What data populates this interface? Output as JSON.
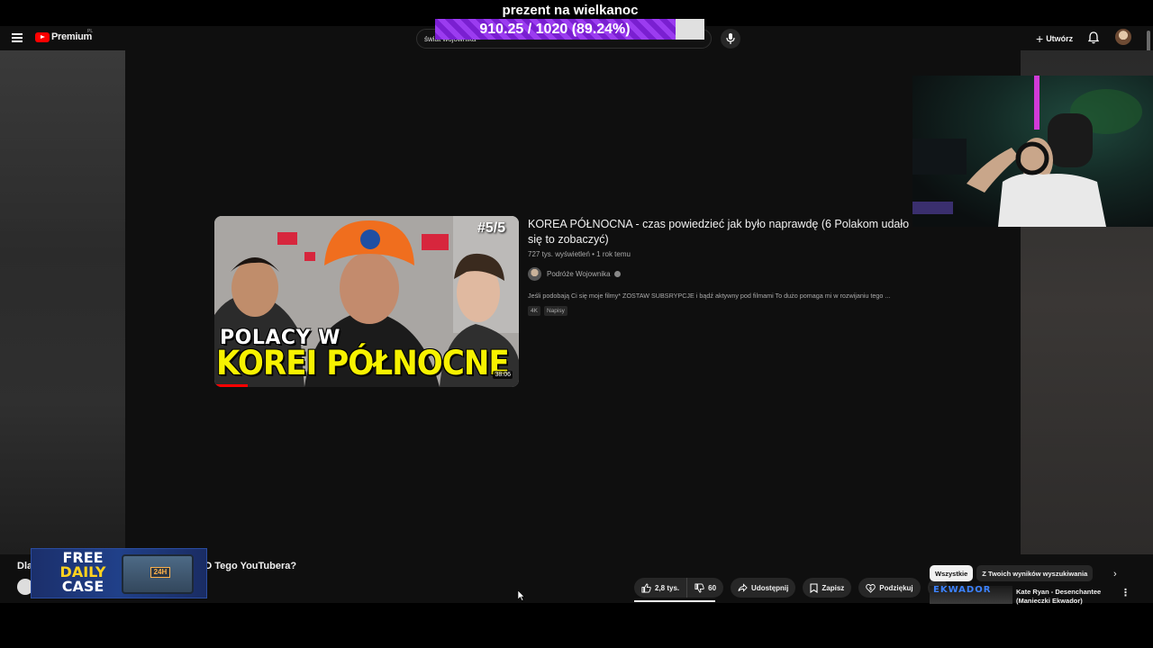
{
  "overlay": {
    "goal_title": "prezent na wielkanoc",
    "goal_progress_text": "910.25 / 1020 (89.24%)",
    "goal_fraction": 0.8924,
    "goal_color": "#8a2be2"
  },
  "header": {
    "logo_text": "Premium",
    "logo_region": "PL",
    "search_value": "świat wojownika",
    "create_label": "Utwórz"
  },
  "result": {
    "title": "KOREA PÓŁNOCNA - czas powiedzieć jak było naprawdę (6 Polakom udało się to zobaczyć)",
    "meta": "727 tys. wyświetleń • 1 rok temu",
    "channel": "Podróże Wojownika",
    "description": "Jeśli podobają Ci się moje filmy* ZOSTAW SUBSRYPCJE i bądź aktywny pod filmami To dużo pomaga mi w rozwijaniu tego ...",
    "badges": [
      "4K",
      "Napisy"
    ],
    "thumb_line1": "POLACY W",
    "thumb_line2": "KOREI PÓŁNOCNE !",
    "thumb_part": "#5/5",
    "duration": "38:06"
  },
  "watch": {
    "title_start": "Dla",
    "title_end": "IĘ OD Tego YouTubera?",
    "likes": "2,8 tys.",
    "dislikes": "60",
    "share_label": "Udostępnij",
    "save_label": "Zapisz",
    "thanks_label": "Podziękuj"
  },
  "promo": {
    "line1": "FREE",
    "line2": "DAILY",
    "line3": "CASE",
    "chest_label": "24H"
  },
  "sidebar": {
    "chips": [
      "Wszystkie",
      "Z Twoich wyników wyszukiwania"
    ],
    "rec_thumb_text": "EKWADOR",
    "rec_title": "Kate Ryan - Desenchantee (Manieczki Ekwador)"
  }
}
